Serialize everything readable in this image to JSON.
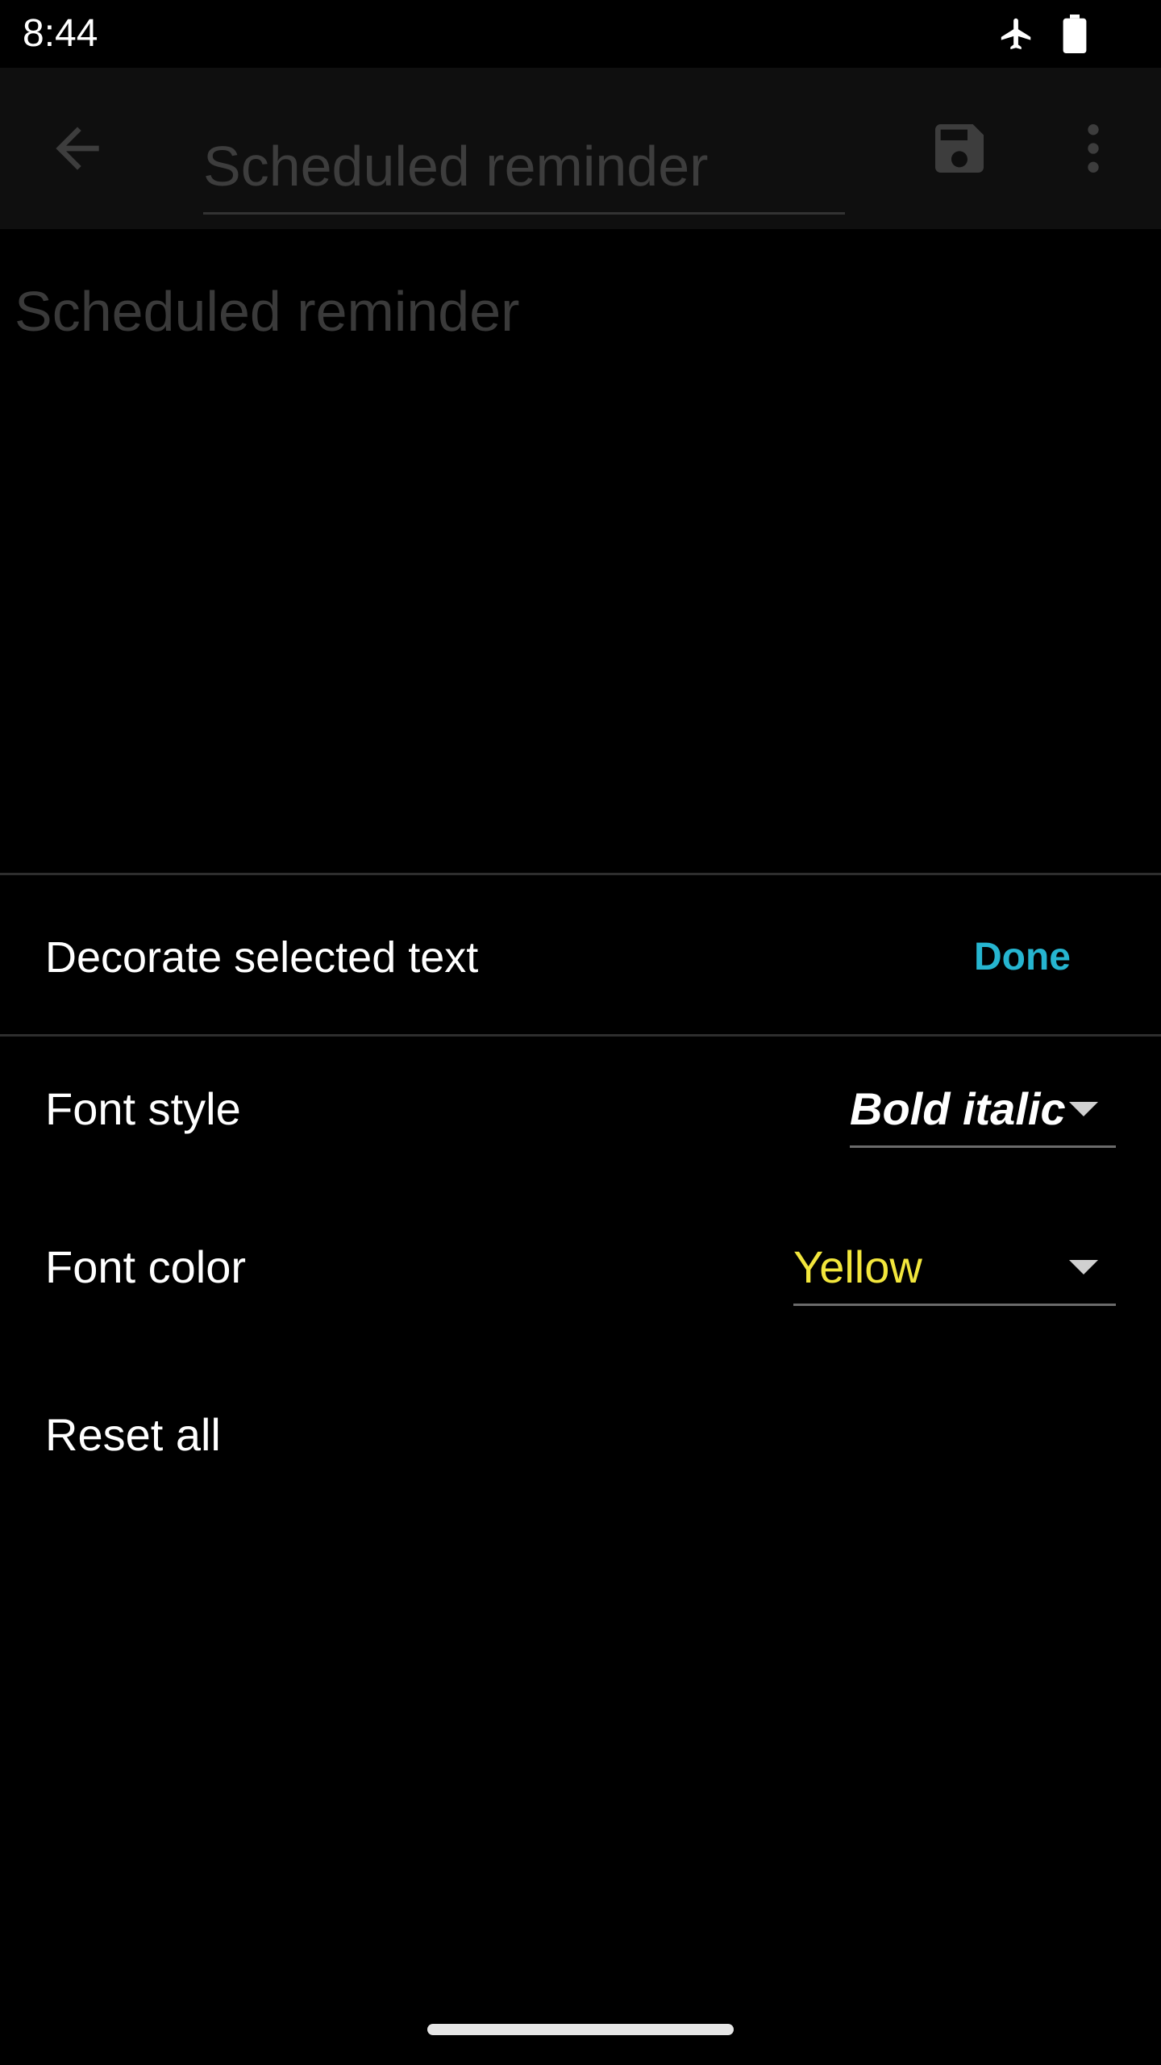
{
  "status_bar": {
    "time": "8:44",
    "icons": [
      "airplane-mode-icon",
      "battery-icon"
    ]
  },
  "app_bar": {
    "back_icon": "arrow-back-icon",
    "title_value": "Scheduled reminder",
    "save_icon": "save-icon",
    "more_icon": "more-vert-icon"
  },
  "note": {
    "body_text": "Scheduled reminder"
  },
  "sheet": {
    "title": "Decorate selected text",
    "done_label": "Done",
    "font_style": {
      "label": "Font style",
      "value": "Bold italic"
    },
    "font_color": {
      "label": "Font color",
      "value": "Yellow"
    },
    "reset_label": "Reset all"
  },
  "colors": {
    "accent": "#26b5d0",
    "font_color_value": "#f2e63c",
    "background": "#000000"
  }
}
